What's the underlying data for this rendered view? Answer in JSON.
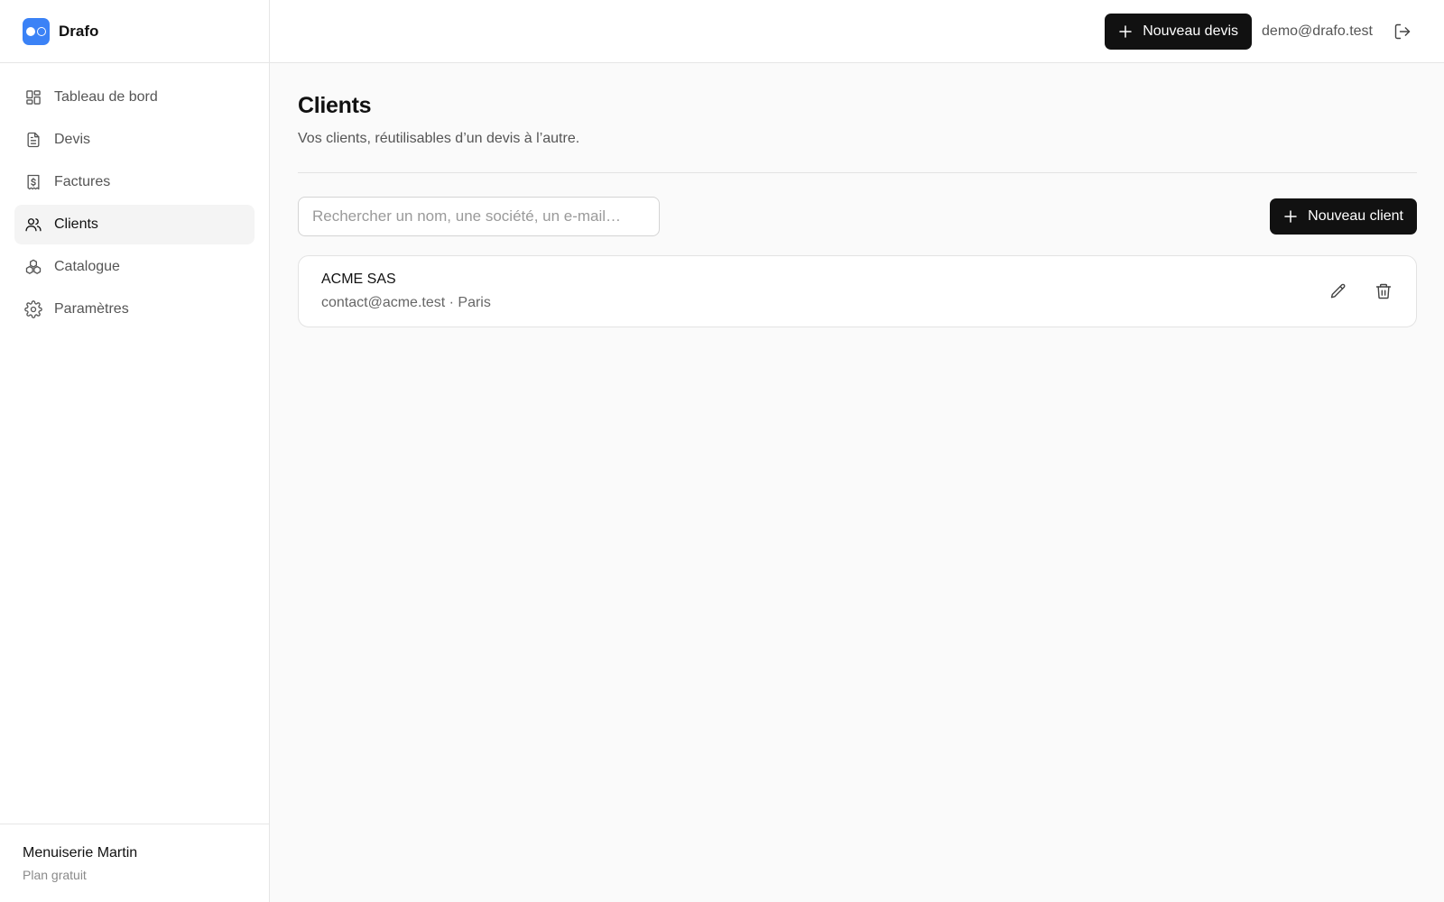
{
  "app": {
    "name": "Drafo"
  },
  "sidebar": {
    "items": [
      {
        "label": "Tableau de bord",
        "icon": "dashboard-icon"
      },
      {
        "label": "Devis",
        "icon": "document-icon"
      },
      {
        "label": "Factures",
        "icon": "invoice-icon"
      },
      {
        "label": "Clients",
        "icon": "users-icon",
        "active": true
      },
      {
        "label": "Catalogue",
        "icon": "catalogue-icon"
      },
      {
        "label": "Paramètres",
        "icon": "gear-icon"
      }
    ],
    "footer": {
      "org": "Menuiserie Martin",
      "plan": "Plan gratuit"
    }
  },
  "topbar": {
    "new_quote_label": "Nouveau devis",
    "user_email": "demo@drafo.test"
  },
  "page": {
    "title": "Clients",
    "subtitle": "Vos clients, réutilisables d’un devis à l’autre."
  },
  "search": {
    "placeholder": "Rechercher un nom, une société, un e-mail…",
    "value": ""
  },
  "new_client_label": "Nouveau client",
  "clients": [
    {
      "name": "ACME SAS",
      "meta": "contact@acme.test · Paris"
    }
  ],
  "colors": {
    "accent": "#3b82f6",
    "primary_button": "#111111",
    "active_nav_bg": "#f4f4f4"
  }
}
